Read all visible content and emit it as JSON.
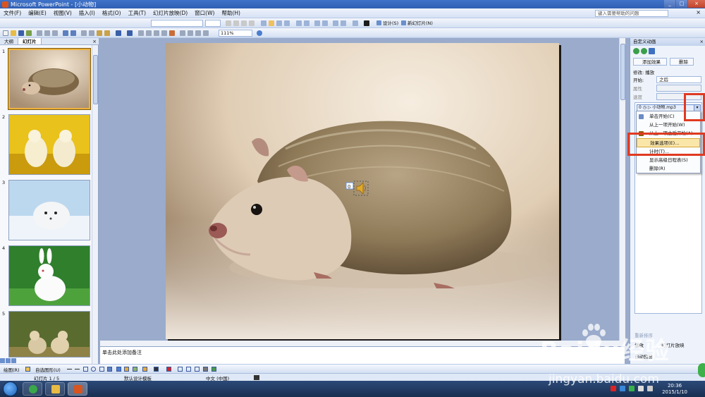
{
  "window": {
    "title": "Microsoft PowerPoint - [小动物]",
    "help_placeholder": "键入需要帮助的问题",
    "help_close": "×"
  },
  "menu": [
    "文件(F)",
    "编辑(E)",
    "视图(V)",
    "插入(I)",
    "格式(O)",
    "工具(T)",
    "幻灯片放映(D)",
    "窗口(W)",
    "帮助(H)"
  ],
  "toolbar": {
    "zoom": "111%",
    "design_label": "设计(S)",
    "new_slide_label": "新幻灯片(N)",
    "font_name": "",
    "font_size": ""
  },
  "slide_pane": {
    "tab_outline": "大纲",
    "tab_slides": "幻灯片",
    "close": "×",
    "slides": [
      {
        "num": "1",
        "subject": "hedgehog"
      },
      {
        "num": "2",
        "subject": "yellow puppies"
      },
      {
        "num": "3",
        "subject": "seal pup"
      },
      {
        "num": "4",
        "subject": "white rabbit"
      },
      {
        "num": "5",
        "subject": "chicks"
      }
    ]
  },
  "notes": {
    "placeholder": "单击此处添加备注"
  },
  "task_pane": {
    "title": "自定义动画",
    "close": "×",
    "add_effect": "添加效果",
    "remove": "删除",
    "modify_label": "修改: 播放",
    "start_label": "开始:",
    "start_value": "之后",
    "property_label": "属性",
    "speed_label": "速度",
    "anim_entry": "0 ◷  ▷  小动物.mp3",
    "reorder_label": "重新排序",
    "play_label": "播放",
    "slideshow_label": "幻灯片放映",
    "autopreview_label": "自动预览"
  },
  "context_menu": [
    {
      "label": "单击开始(C)",
      "highlighted": false
    },
    {
      "label": "从上一项开始(W)",
      "highlighted": false
    },
    {
      "label": "从上一项之后开始(A)",
      "highlighted": false
    },
    {
      "label": "效果选项(E)...",
      "highlighted": true
    },
    {
      "label": "计时(T)...",
      "highlighted": false
    },
    {
      "label": "显示高级日程表(S)",
      "highlighted": false
    },
    {
      "label": "删除(R)",
      "highlighted": false
    }
  ],
  "drawing_toolbar": {
    "draw_label": "绘图(R)",
    "autoshapes_label": "自选图形(U)"
  },
  "status": {
    "slide_counter": "幻灯片 1 / 5",
    "design": "默认设计模板",
    "language": "中文 (中国)"
  },
  "taskbar": {
    "time": "20:36",
    "date": "2015/1/10"
  },
  "watermark": {
    "brand": "Baidu经验",
    "url": "jingyan.baidu.com"
  },
  "colors": {
    "accent": "#2f5fb3",
    "highlight": "#e03a22"
  },
  "slide_audio_marker": "0"
}
